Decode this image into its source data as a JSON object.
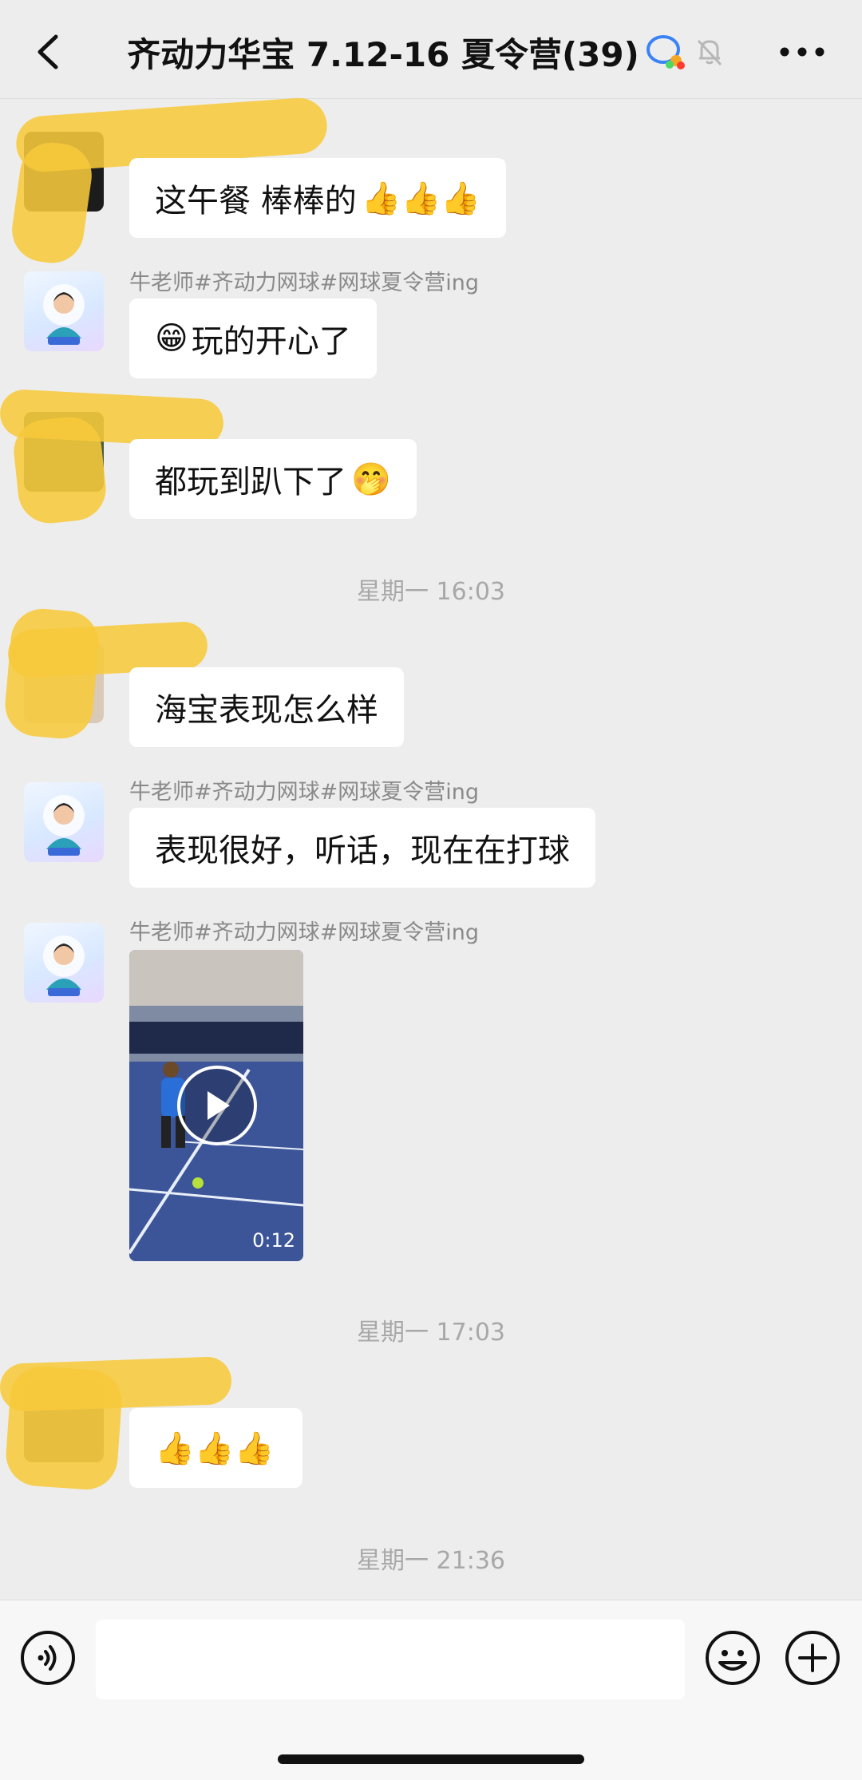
{
  "header": {
    "title": "齐动力华宝 7.12-16 夏令营(39)",
    "back_icon": "chevron-left-icon",
    "more_icon": "ellipsis-icon",
    "muted_icon": "bell-muted-icon",
    "group_icon": "chat-bubbles-icon"
  },
  "messages": [
    {
      "sender": "",
      "text": "这午餐 棒棒的",
      "emoji": "👍👍👍",
      "avatar": "redacted"
    },
    {
      "sender": "牛老师#齐动力网球#网球夏令营ing",
      "emoji_lead": "😁",
      "text": "玩的开心了",
      "avatar": "teacher"
    },
    {
      "sender": "",
      "text": "都玩到趴下了",
      "emoji": "🤭",
      "avatar": "redacted"
    },
    {
      "timestamp": "星期一 16:03"
    },
    {
      "sender": "",
      "text": "海宝表现怎么样",
      "avatar": "redacted"
    },
    {
      "sender": "牛老师#齐动力网球#网球夏令营ing",
      "text": "表现很好，听话，现在在打球",
      "avatar": "teacher"
    },
    {
      "sender": "牛老师#齐动力网球#网球夏令营ing",
      "type": "video",
      "duration": "0:12",
      "avatar": "teacher"
    },
    {
      "timestamp": "星期一 17:03"
    },
    {
      "sender": "",
      "emoji": "👍👍👍",
      "avatar": "redacted"
    },
    {
      "timestamp": "星期一 21:36"
    }
  ],
  "input_bar": {
    "placeholder": "",
    "voice_icon": "voice-icon",
    "emoji_icon": "smiley-icon",
    "plus_icon": "plus-circle-icon"
  },
  "colors": {
    "background": "#ededed",
    "bubble": "#ffffff",
    "meta_text": "#8a8a8a",
    "redaction": "#f7c93b"
  }
}
